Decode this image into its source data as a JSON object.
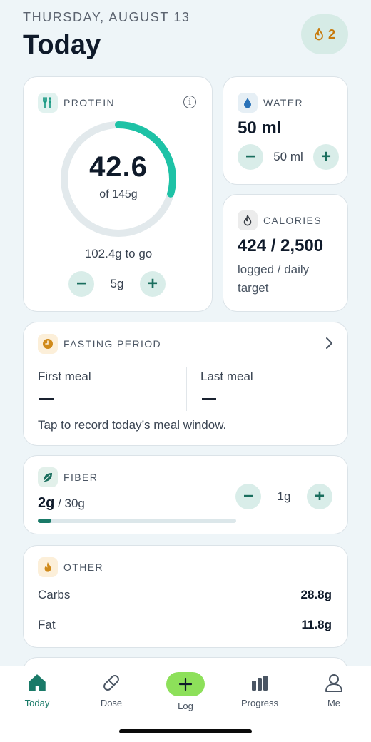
{
  "header": {
    "date": "THURSDAY, AUGUST 13",
    "title": "Today",
    "streak": "2"
  },
  "protein": {
    "label": "PROTEIN",
    "value": "42.6",
    "of": "of 145g",
    "progress": 0.294,
    "to_go": "102.4g to go",
    "step": "5g",
    "info": "i"
  },
  "water": {
    "label": "WATER",
    "amount": "50 ml",
    "step": "50 ml"
  },
  "calories": {
    "label": "CALORIES",
    "value": "424 / 2,500",
    "desc_line1": "logged / daily",
    "desc_line2": "target"
  },
  "fasting": {
    "label": "FASTING PERIOD",
    "first_meal": "First meal",
    "last_meal": "Last meal",
    "hint": "Tap to record today’s meal window."
  },
  "fiber": {
    "label": "FIBER",
    "value": "2g",
    "target": " / 30g",
    "step": "1g",
    "progress": 0.067
  },
  "other": {
    "label": "OTHER",
    "rows": [
      {
        "name": "Carbs",
        "value": "28.8g"
      },
      {
        "name": "Fat",
        "value": "11.8g"
      }
    ]
  },
  "tabs": [
    {
      "label": "Today",
      "icon": "home-icon",
      "active": true
    },
    {
      "label": "Dose",
      "icon": "pill-icon",
      "active": false
    },
    {
      "label": "Log",
      "icon": "plus-icon",
      "active": false
    },
    {
      "label": "Progress",
      "icon": "bar-chart-icon",
      "active": false
    },
    {
      "label": "Me",
      "icon": "person-icon",
      "active": false
    }
  ],
  "colors": {
    "accent": "#1ec2a6",
    "brand_green": "#1a7a68",
    "log_button": "#8de05a",
    "streak": "#c87a0c"
  }
}
